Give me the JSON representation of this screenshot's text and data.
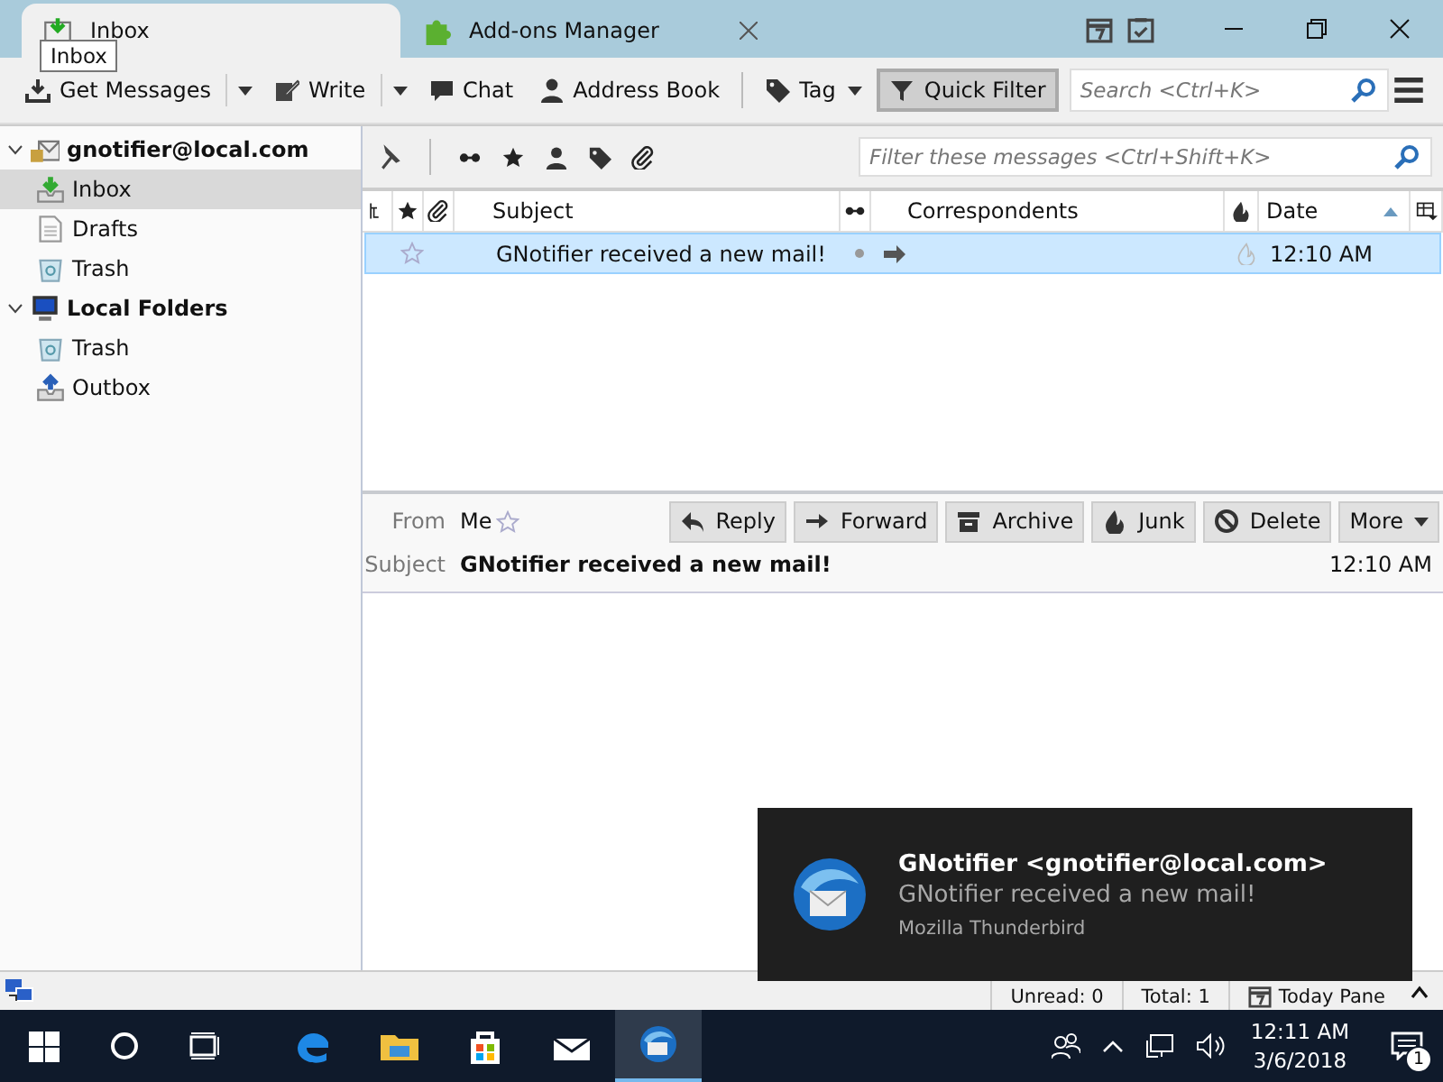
{
  "tabs": [
    {
      "label": "Inbox",
      "kind": "mail",
      "selected": true
    },
    {
      "label": "Add-ons Manager",
      "kind": "addons",
      "selected": false
    }
  ],
  "tooltip": "Inbox",
  "toolbar": {
    "buttons": [
      {
        "label": "Get Messages",
        "kind": "download",
        "dropdown": true,
        "pressed": false
      },
      {
        "label": "Write",
        "kind": "pencil",
        "dropdown": true,
        "pressed": false
      },
      {
        "label": "Chat",
        "kind": "chat",
        "dropdown": false,
        "pressed": false
      },
      {
        "label": "Address Book",
        "kind": "person",
        "dropdown": false,
        "pressed": false
      },
      {
        "label": "Tag",
        "kind": "tag",
        "dropdown": true,
        "pressed": false
      },
      {
        "label": "Quick Filter",
        "kind": "filter",
        "dropdown": false,
        "pressed": true
      }
    ],
    "search": {
      "placeholder": "Search <Ctrl+K>"
    }
  },
  "folders": [
    {
      "label": "gnotifier@local.com",
      "kind": "account",
      "expanded": true,
      "selected": false,
      "children": [
        {
          "label": "Inbox",
          "kind": "inbox",
          "selected": true
        },
        {
          "label": "Drafts",
          "kind": "drafts",
          "selected": false
        },
        {
          "label": "Trash",
          "kind": "trash",
          "selected": false
        }
      ]
    },
    {
      "label": "Local Folders",
      "kind": "local",
      "expanded": true,
      "selected": false,
      "children": [
        {
          "label": "Trash",
          "kind": "trash",
          "selected": false
        },
        {
          "label": "Outbox",
          "kind": "outbox",
          "selected": false
        }
      ]
    }
  ],
  "quick_filter": {
    "placeholder": "Filter these messages <Ctrl+Shift+K>"
  },
  "message_list": {
    "columns": [
      {
        "kind": "thread"
      },
      {
        "kind": "star"
      },
      {
        "kind": "attachment"
      },
      {
        "kind": "subject",
        "label": "Subject"
      },
      {
        "kind": "read"
      },
      {
        "kind": "correspondents",
        "label": "Correspondents"
      },
      {
        "kind": "junk"
      },
      {
        "kind": "date",
        "label": "Date",
        "sorted": true
      },
      {
        "kind": "picker"
      }
    ],
    "rows": [
      {
        "subject": "GNotifier received a new mail!",
        "date": "12:10 AM",
        "selected": true,
        "starred": false
      }
    ]
  },
  "header": {
    "from_label": "From",
    "from": "Me",
    "subject_label": "Subject",
    "subject": "GNotifier received a new mail!",
    "date": "12:10 AM",
    "buttons": [
      {
        "label": "Reply",
        "kind": "reply"
      },
      {
        "label": "Forward",
        "kind": "forward"
      },
      {
        "label": "Archive",
        "kind": "archive"
      },
      {
        "label": "Junk",
        "kind": "junk"
      },
      {
        "label": "Delete",
        "kind": "delete"
      },
      {
        "label": "More",
        "kind": "more"
      }
    ]
  },
  "status_bar": {
    "unread": "Unread: 0",
    "total": "Total: 1",
    "today_pane": "Today Pane"
  },
  "notification": {
    "title": "GNotifier <gnotifier@local.com>",
    "message": "GNotifier received a new mail!",
    "app": "Mozilla Thunderbird"
  },
  "taskbar": {
    "apps": [
      {
        "kind": "edge",
        "active": false
      },
      {
        "kind": "explorer",
        "active": false
      },
      {
        "kind": "store",
        "active": false
      },
      {
        "kind": "mail",
        "active": false
      },
      {
        "kind": "thunderbird",
        "active": true
      }
    ],
    "time": "12:11 AM",
    "date": "3/6/2018",
    "notification_count": "1"
  }
}
